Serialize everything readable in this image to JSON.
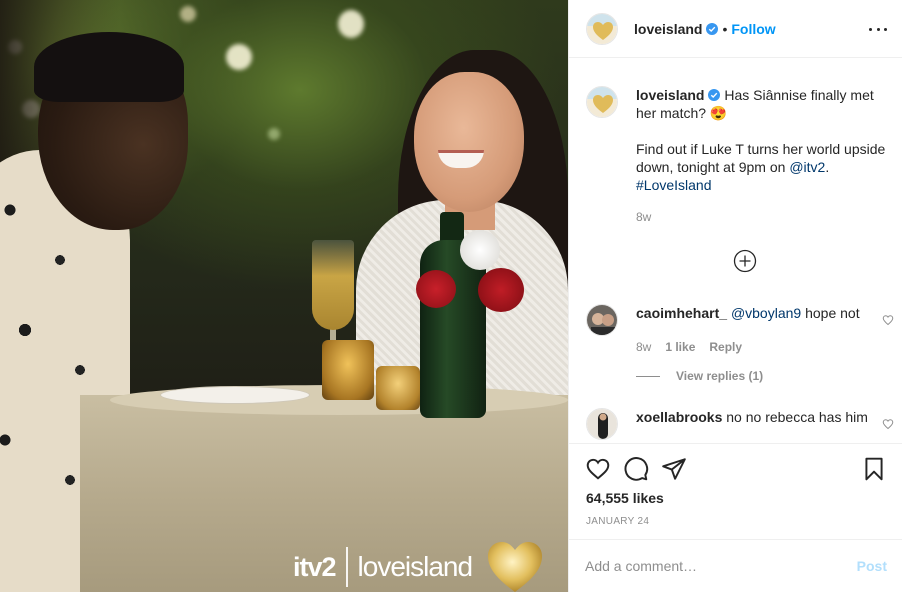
{
  "post": {
    "username": "loveisland",
    "dot": "•",
    "follow_label": "Follow",
    "caption_line1": "Has Siânnise finally met her match? 😍",
    "caption_line2a": "Find out if Luke T turns her world upside down, tonight at 9pm on ",
    "mention": "@itv2",
    "hashtag": "#LoveIsland",
    "caption_time": "8w",
    "likes": "64,555 likes",
    "date": "JANUARY 24"
  },
  "photo": {
    "watermark_brand": "itv2",
    "watermark_show": "loveisland"
  },
  "comments": [
    {
      "username": "caoimhehart_",
      "mention": "@vboylan9",
      "text": " hope not",
      "time": "8w",
      "likes": "1 like",
      "reply_label": "Reply",
      "view_replies": "View replies (1)"
    },
    {
      "username": "xoellabrooks",
      "text": " no no rebecca has him"
    }
  ],
  "composer": {
    "placeholder": "Add a comment…",
    "post_label": "Post"
  },
  "colors": {
    "accent": "#0095f6",
    "post_disabled": "#b2dffc",
    "muted": "#8e8e8e"
  }
}
